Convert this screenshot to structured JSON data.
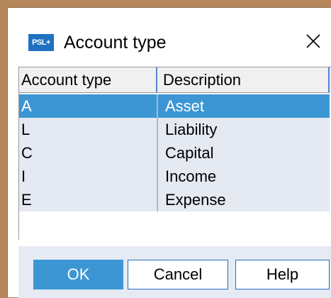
{
  "window": {
    "title": "Account type",
    "app_icon_text": "PSL+",
    "close_glyph": "close-icon"
  },
  "grid": {
    "columns": [
      "Account type",
      "Description"
    ],
    "rows": [
      {
        "code": "A",
        "description": "Asset",
        "selected": true
      },
      {
        "code": "L",
        "description": "Liability",
        "selected": false
      },
      {
        "code": "C",
        "description": "Capital",
        "selected": false
      },
      {
        "code": "I",
        "description": "Income",
        "selected": false
      },
      {
        "code": "E",
        "description": "Expense",
        "selected": false
      }
    ]
  },
  "buttons": {
    "ok": "OK",
    "cancel": "Cancel",
    "help": "Help"
  },
  "colors": {
    "selection": "#3c96d4",
    "row_background": "#e4e9f2",
    "button_bar": "#e6ebf3",
    "accent_border": "#1f6fc0"
  }
}
